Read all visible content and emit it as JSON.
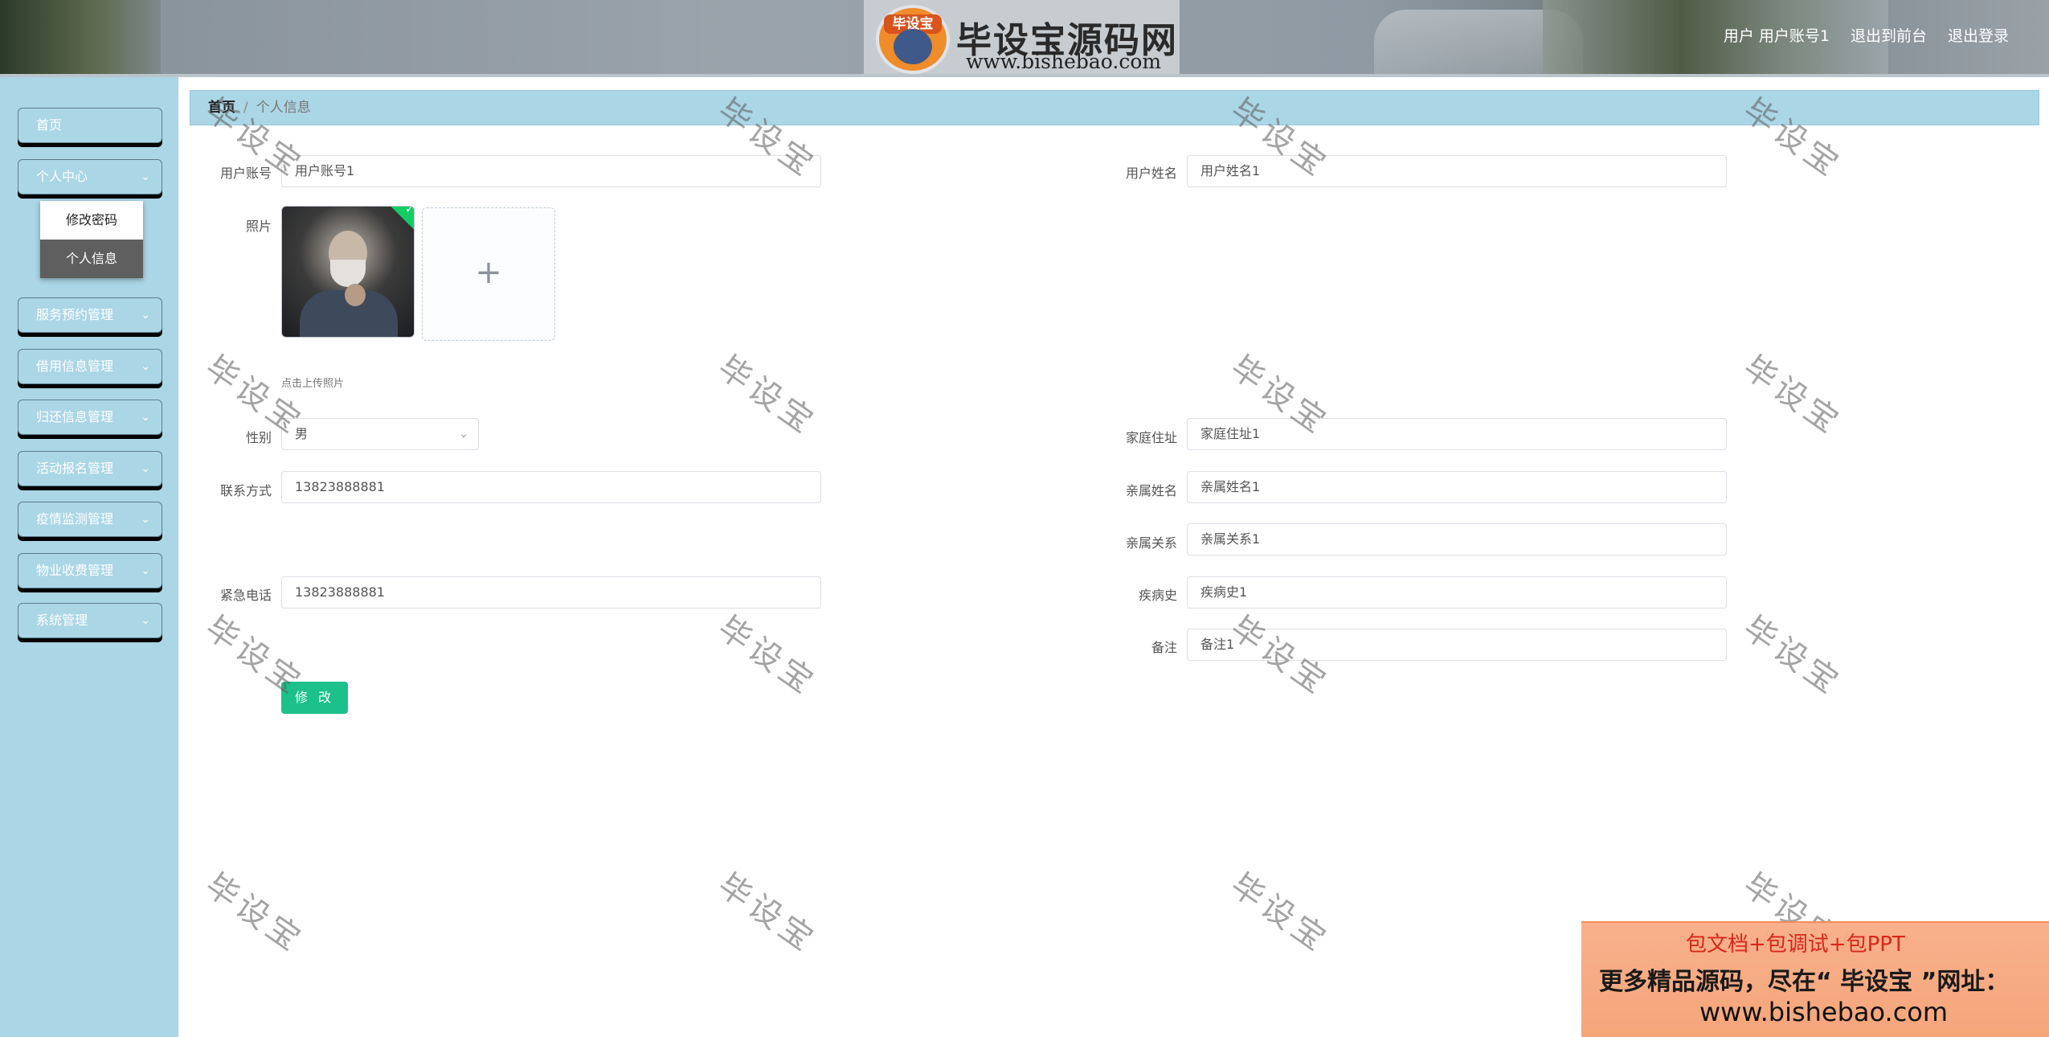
{
  "header": {
    "logo_title": "毕设宝源码网",
    "logo_cap": "毕设宝",
    "logo_url": "www.bishebao.com",
    "user_label": "用户 用户账号1",
    "front_link": "退出到前台",
    "logout_link": "退出登录"
  },
  "sidebar": {
    "items": [
      {
        "label": "首页"
      },
      {
        "label": "个人中心"
      },
      {
        "label": "服务预约管理"
      },
      {
        "label": "借用信息管理"
      },
      {
        "label": "归还信息管理"
      },
      {
        "label": "活动报名管理"
      },
      {
        "label": "疫情监测管理"
      },
      {
        "label": "物业收费管理"
      },
      {
        "label": "系统管理"
      }
    ],
    "submenu": [
      {
        "label": "修改密码"
      },
      {
        "label": "个人信息"
      }
    ]
  },
  "breadcrumb": {
    "home": "首页",
    "current": "个人信息"
  },
  "form": {
    "account_label": "用户账号",
    "account_value": "用户账号1",
    "name_label": "用户姓名",
    "name_value": "用户姓名1",
    "photo_label": "照片",
    "photo_tip": "点击上传照片",
    "gender_label": "性别",
    "gender_value": "男",
    "address_label": "家庭住址",
    "address_value": "家庭住址1",
    "phone_label": "联系方式",
    "phone_value": "13823888881",
    "relative_name_label": "亲属姓名",
    "relative_name_value": "亲属姓名1",
    "relation_label": "亲属关系",
    "relation_value": "亲属关系1",
    "emergency_label": "紧急电话",
    "emergency_value": "13823888881",
    "history_label": "疾病史",
    "history_value": "疾病史1",
    "remark_label": "备注",
    "remark_value": "备注1",
    "submit_label": "修 改"
  },
  "watermark": "毕设宝",
  "ad": {
    "line1": "包文档+包调试+包PPT",
    "line2": "更多精品源码，尽在“ 毕设宝 ”网址：",
    "line3": "www.bishebao.com"
  },
  "colors": {
    "sidebar": "#abd6e6",
    "submit": "#1cc08a",
    "submenu_active": "#5f5f5f"
  }
}
